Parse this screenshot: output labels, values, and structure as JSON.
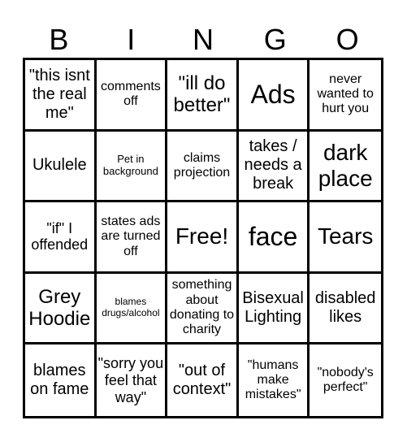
{
  "header": [
    "B",
    "I",
    "N",
    "G",
    "O"
  ],
  "cells": [
    "\"this isnt the real me\"",
    "comments off",
    "\"ill do better\"",
    "Ads",
    "never wanted to hurt you",
    "Ukulele",
    "Pet in background",
    "claims projection",
    "takes / needs a break",
    "dark place",
    "\"if\" I offended",
    "states ads are turned off",
    "Free!",
    "face",
    "Tears",
    "Grey Hoodie",
    "blames drugs/alcohol",
    "something about donating to charity",
    "Bisexual Lighting",
    "disabled likes",
    "blames on fame",
    "\"sorry you feel that way\"",
    "\"out of context\"",
    "\"humans make mistakes\"",
    "\"nobody's perfect\""
  ]
}
